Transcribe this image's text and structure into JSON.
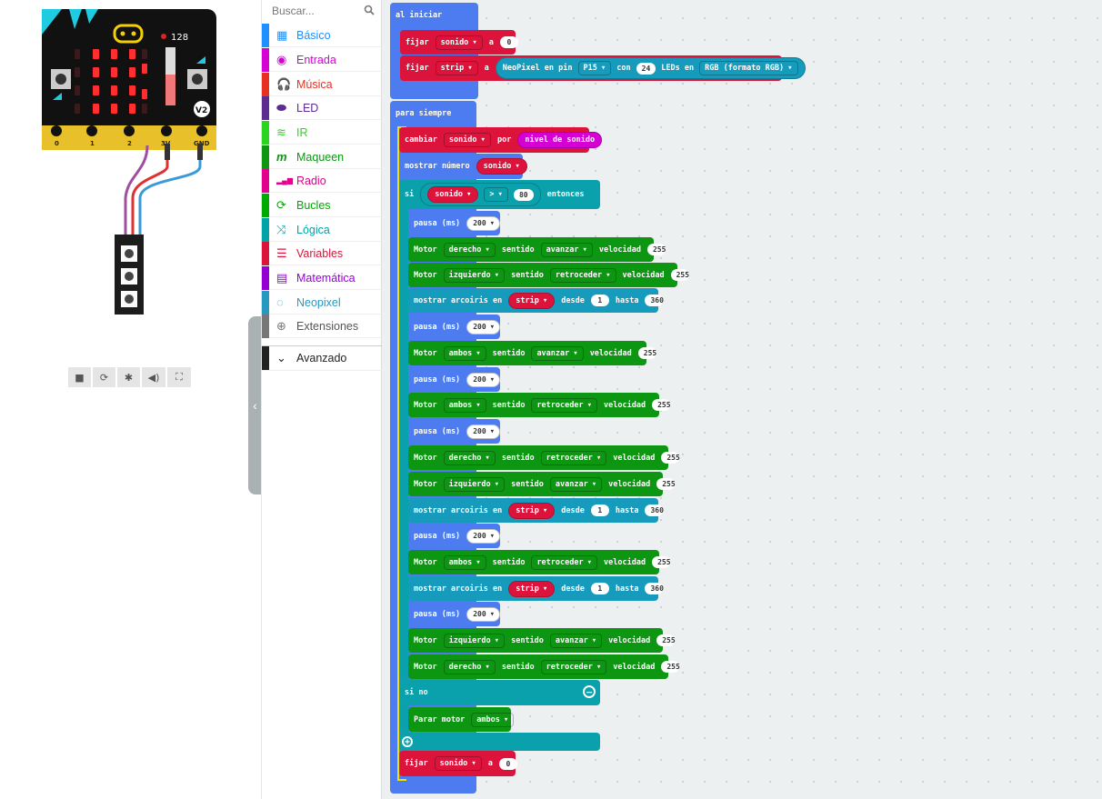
{
  "simulator": {
    "level_value": "128",
    "version_badge": "V2",
    "pins": [
      "0",
      "1",
      "2",
      "3V",
      "GND"
    ],
    "buttons": {
      "a": "A",
      "b": "B"
    }
  },
  "toolbox": {
    "search_placeholder": "Buscar...",
    "categories": [
      {
        "label": "Básico",
        "color": "#1e90ff",
        "icon": "grid-icon"
      },
      {
        "label": "Entrada",
        "color": "#d400d4",
        "icon": "radio-circle-icon"
      },
      {
        "label": "Música",
        "color": "#e63022",
        "icon": "headphones-icon"
      },
      {
        "label": "LED",
        "color": "#5c2d91",
        "icon": "toggle-icon"
      },
      {
        "label": "IR",
        "color": "#2bd420",
        "icon": "wifi-icon"
      },
      {
        "label": "Maqueen",
        "color": "#0c9612",
        "icon": "m-icon"
      },
      {
        "label": "Radio",
        "color": "#e3008c",
        "icon": "signal-bars-icon"
      },
      {
        "label": "Bucles",
        "color": "#00aa00",
        "icon": "refresh-icon"
      },
      {
        "label": "Lógica",
        "color": "#00a4a6",
        "icon": "shuffle-icon"
      },
      {
        "label": "Variables",
        "color": "#dc143c",
        "icon": "lines-icon"
      },
      {
        "label": "Matemática",
        "color": "#9400d3",
        "icon": "calculator-icon"
      },
      {
        "label": "Neopixel",
        "color": "#2699bf",
        "icon": "dotted-circle-icon"
      },
      {
        "label": "Extensiones",
        "color": "#777777",
        "icon": "plus-circle-icon"
      },
      {
        "label": "Avanzado",
        "color": "#222222",
        "icon": "chevron-down-icon"
      }
    ]
  },
  "workspace": {
    "on_start": {
      "header": "al iniciar",
      "set1": {
        "kw": "fijar",
        "var": "sonido",
        "to": "a",
        "val": "0"
      },
      "set2": {
        "kw": "fijar",
        "var": "strip",
        "to": "a",
        "fn": "NeoPixel en pin",
        "pin": "P15",
        "con": "con",
        "count": "24",
        "leds": "LEDs en",
        "mode": "RGB (formato RGB)"
      }
    },
    "forever": {
      "header": "para siempre",
      "change": {
        "kw": "cambiar",
        "var": "sonido",
        "por": "por",
        "val": "nivel de sonido"
      },
      "show": {
        "kw": "mostrar número",
        "var": "sonido"
      },
      "if": {
        "kw": "si",
        "var": "sonido",
        "op": ">",
        "val": "80",
        "then": "entonces"
      },
      "else": "si no",
      "stop": {
        "kw": "Parar motor",
        "which": "ambos"
      },
      "set_end": {
        "kw": "fijar",
        "var": "sonido",
        "to": "a",
        "val": "0"
      }
    },
    "labels": {
      "pause": "pausa (ms)",
      "pause_val": "200",
      "motor": "Motor",
      "dir": "sentido",
      "speed": "velocidad",
      "speed_val": "255",
      "rainbow": "mostrar arcoiris en",
      "strip": "strip",
      "from": "desde",
      "from_val": "1",
      "to": "hasta",
      "to_val": "360",
      "right": "derecho",
      "left": "izquierdo",
      "both": "ambos",
      "fwd": "avanzar",
      "back": "retroceder"
    }
  }
}
